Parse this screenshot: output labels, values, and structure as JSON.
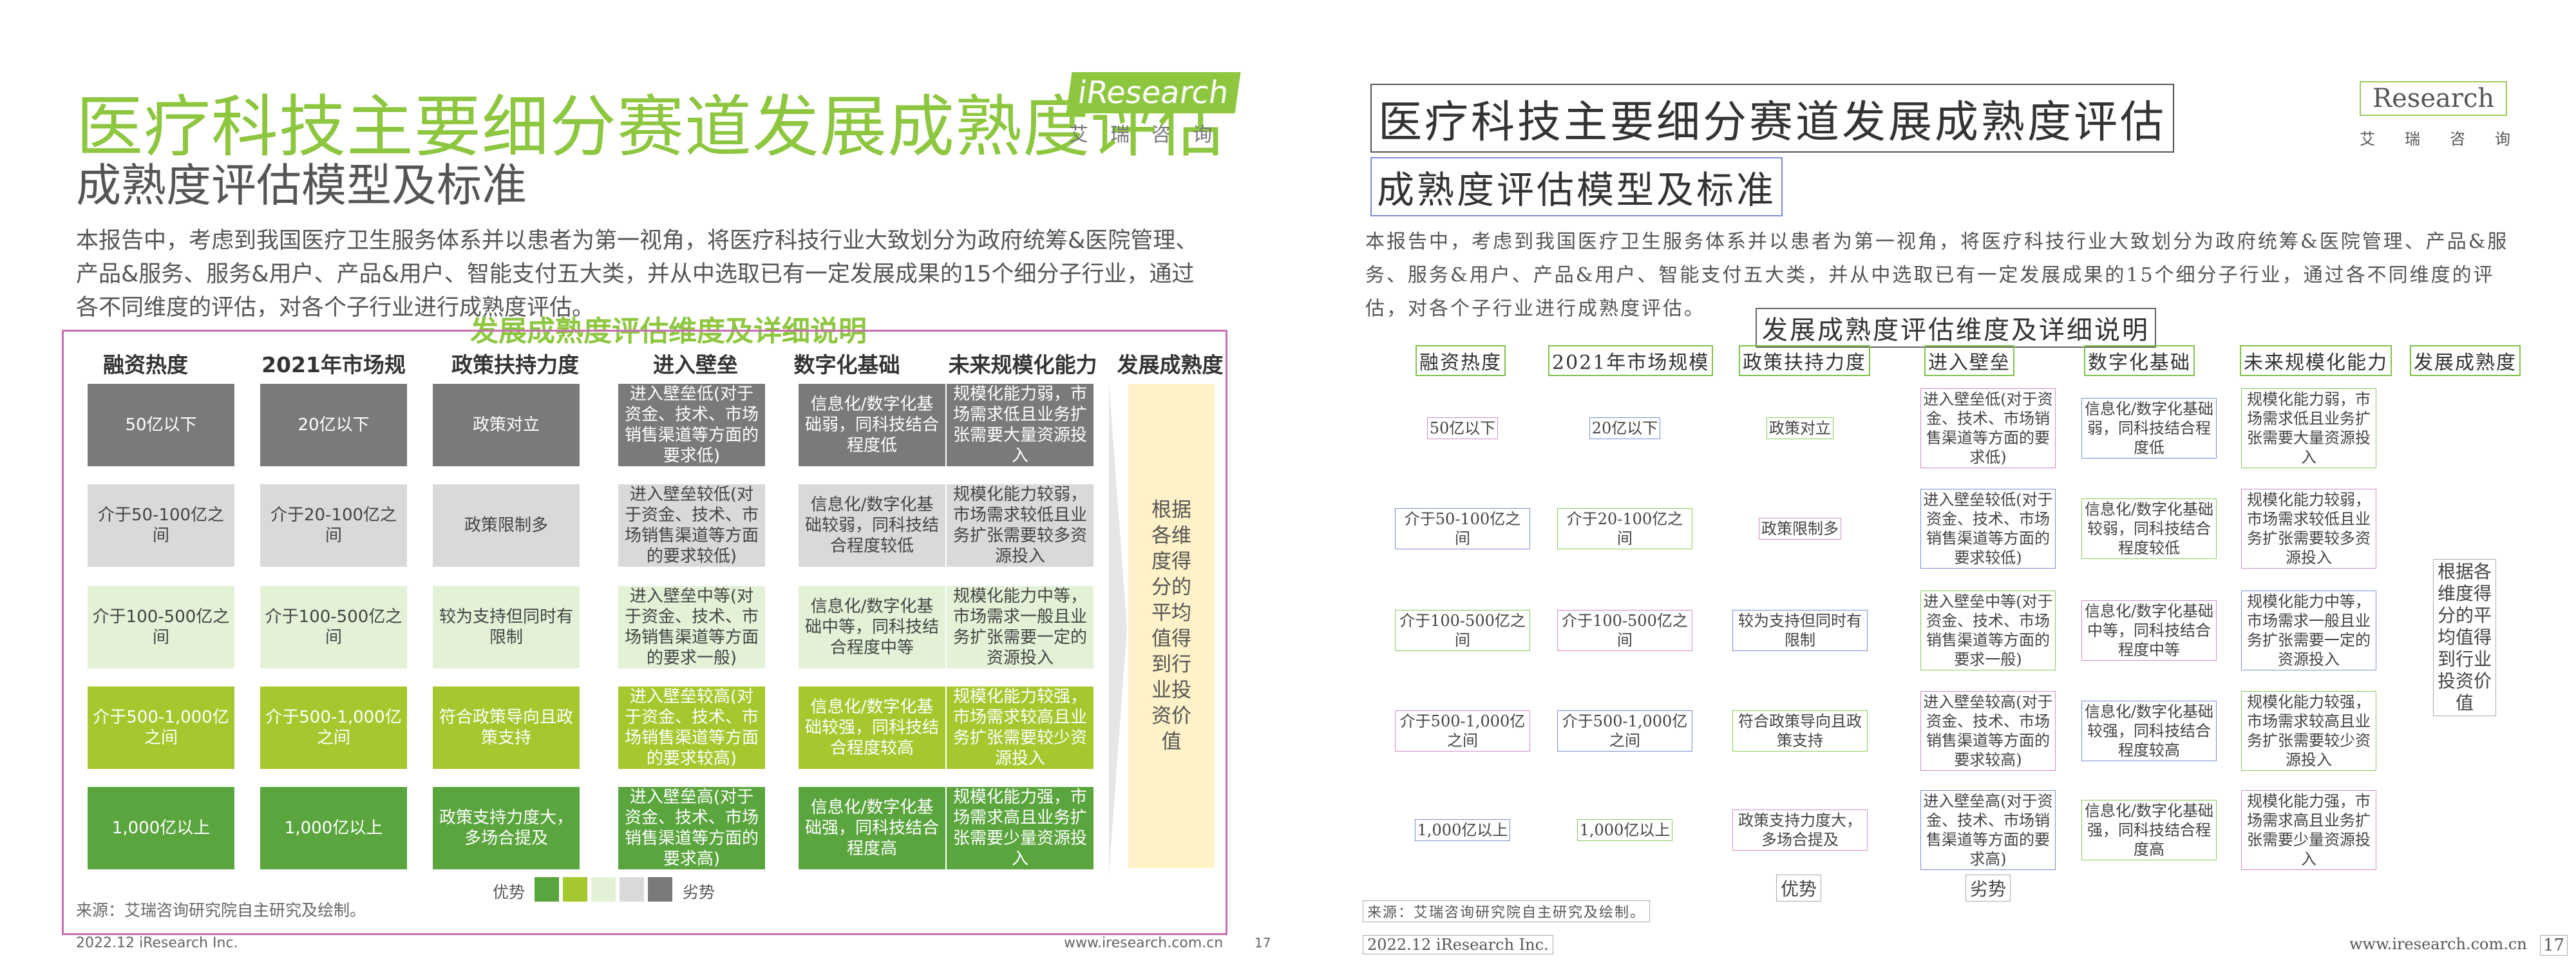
{
  "title": "医疗科技主要细分赛道发展成熟度评估",
  "subtitle": "成熟度评估模型及标准",
  "logo": {
    "word": "iResearch",
    "word_right": "Research",
    "cn": "艾瑞咨询"
  },
  "intro": "本报告中，考虑到我国医疗卫生服务体系并以患者为第一视角，将医疗科技行业大致划分为政府统筹&医院管理、产品&服务、服务&用户、产品&用户、智能支付五大类，并从中选取已有一定发展成果的15个细分子行业，通过各不同维度的评估，对各个子行业进行成熟度评估。",
  "section_title": "发展成熟度评估维度及详细说明",
  "headers": [
    "融资热度",
    "2021年市场规模",
    "政策扶持力度",
    "进入壁垒",
    "数字化基础",
    "未来规模化能力",
    "发展成熟度"
  ],
  "rows": [
    [
      "50亿以下",
      "20亿以下",
      "政策对立",
      "进入壁垒低(对于资金、技术、市场销售渠道等方面的要求低)",
      "信息化/数字化基础弱，同科技结合程度低",
      "规模化能力弱，市场需求低且业务扩张需要大量资源投入"
    ],
    [
      "介于50-100亿之间",
      "介于20-100亿之间",
      "政策限制多",
      "进入壁垒较低(对于资金、技术、市场销售渠道等方面的要求较低)",
      "信息化/数字化基础较弱，同科技结合程度较低",
      "规模化能力较弱，市场需求较低且业务扩张需要较多资源投入"
    ],
    [
      "介于100-500亿之间",
      "介于100-500亿之间",
      "较为支持但同时有限制",
      "进入壁垒中等(对于资金、技术、市场销售渠道等方面的要求一般)",
      "信息化/数字化基础中等，同科技结合程度中等",
      "规模化能力中等，市场需求一般且业务扩张需要一定的资源投入"
    ],
    [
      "介于500-1,000亿之间",
      "介于500-1,000亿之间",
      "符合政策导向且政策支持",
      "进入壁垒较高(对于资金、技术、市场销售渠道等方面的要求较高)",
      "信息化/数字化基础较强，同科技结合程度较高",
      "规模化能力较强，市场需求较高且业务扩张需要较少资源投入"
    ],
    [
      "1,000亿以上",
      "1,000亿以上",
      "政策支持力度大，多场合提及",
      "进入壁垒高(对于资金、技术、市场销售渠道等方面的要求高)",
      "信息化/数字化基础强，同科技结合程度高",
      "规模化能力强，市场需求高且业务扩张需要少量资源投入"
    ]
  ],
  "final_text": "根据各维度得分的平均值得到行业投资价值",
  "legend": {
    "left": "优势",
    "right": "劣势"
  },
  "source": "来源：艾瑞咨询研究院自主研究及绘制。",
  "footer": {
    "left": "2022.12 iResearch Inc.",
    "right": "www.iresearch.com.cn",
    "page": "17"
  },
  "colors": {
    "accent": "#8dc63f",
    "level_colors": [
      "#7a7a7a",
      "#d9d9d9",
      "#e3f2d7",
      "#a5c82e",
      "#5aa53d"
    ]
  }
}
